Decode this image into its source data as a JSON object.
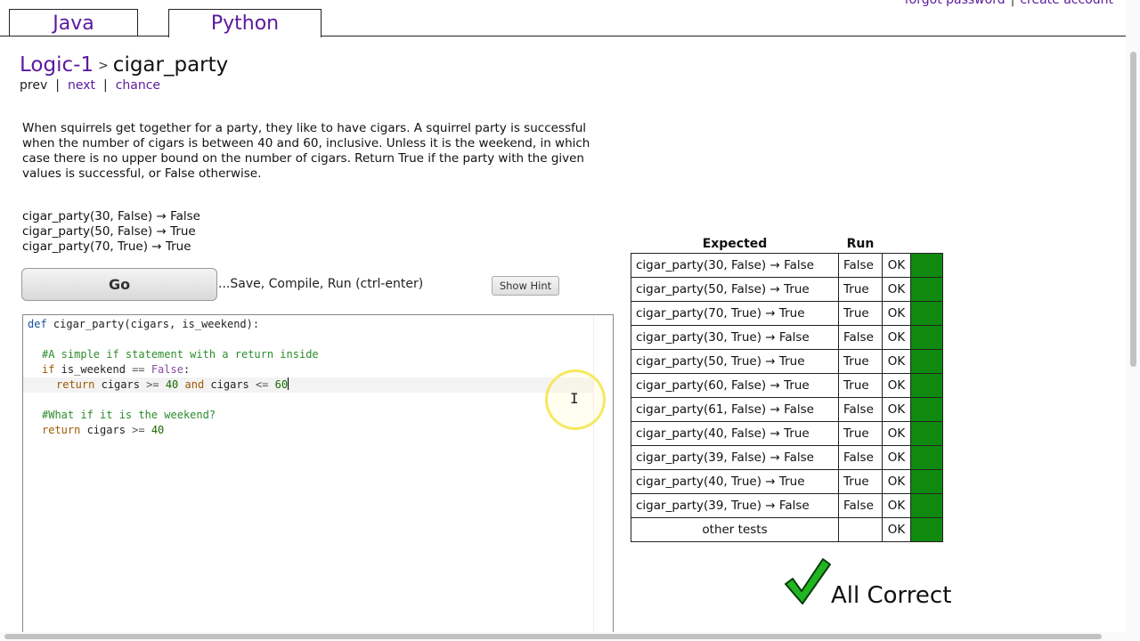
{
  "tabs": [
    {
      "label": "Java"
    },
    {
      "label": "Python"
    }
  ],
  "toplinks": {
    "forgot": "forgot password",
    "create": "create account",
    "sep": "|"
  },
  "title": {
    "crumb": "Logic-1",
    "gt": ">",
    "name": "cigar_party"
  },
  "nav": {
    "prev": "prev",
    "next": "next",
    "chance": "chance",
    "sep": "|"
  },
  "description": "When squirrels get together for a party, they like to have cigars. A squirrel party is successful when the number of cigars is between 40 and 60, inclusive. Unless it is the weekend, in which case there is no upper bound on the number of cigars. Return True if the party with the given values is successful, or False otherwise.",
  "examples": [
    "cigar_party(30, False) → False",
    "cigar_party(50, False) → True",
    "cigar_party(70, True) → True"
  ],
  "go": {
    "label": "Go",
    "text": "...Save, Compile, Run (ctrl-enter)",
    "hint": "Show Hint"
  },
  "code": {
    "l1_def": "def",
    "l1_sig": " cigar_party(cigars, is_weekend):",
    "l2": "#A simple if statement with a return inside",
    "l3_if": "if",
    "l3_mid": " is_weekend ",
    "l3_op": "==",
    "l3_bool": " False",
    "l3_colon": ":",
    "l4_ret": "return",
    "l4_a": " cigars ",
    "l4_op1": ">=",
    "l4_n1": " 40 ",
    "l4_and": "and",
    "l4_b": " cigars ",
    "l4_op2": "<=",
    "l4_n2": " 60",
    "l5": "#What if it is the weekend?",
    "l6_ret": "return",
    "l6_a": " cigars ",
    "l6_op": ">=",
    "l6_n": " 40"
  },
  "results": {
    "headers": {
      "expected": "Expected",
      "run": "Run"
    },
    "rows": [
      {
        "expected": "cigar_party(30, False) → False",
        "run": "False",
        "ok": "OK"
      },
      {
        "expected": "cigar_party(50, False) → True",
        "run": "True",
        "ok": "OK"
      },
      {
        "expected": "cigar_party(70, True) → True",
        "run": "True",
        "ok": "OK"
      },
      {
        "expected": "cigar_party(30, True) → False",
        "run": "False",
        "ok": "OK"
      },
      {
        "expected": "cigar_party(50, True) → True",
        "run": "True",
        "ok": "OK"
      },
      {
        "expected": "cigar_party(60, False) → True",
        "run": "True",
        "ok": "OK"
      },
      {
        "expected": "cigar_party(61, False) → False",
        "run": "False",
        "ok": "OK"
      },
      {
        "expected": "cigar_party(40, False) → True",
        "run": "True",
        "ok": "OK"
      },
      {
        "expected": "cigar_party(39, False) → False",
        "run": "False",
        "ok": "OK"
      },
      {
        "expected": "cigar_party(40, True) → True",
        "run": "True",
        "ok": "OK"
      },
      {
        "expected": "cigar_party(39, True) → False",
        "run": "False",
        "ok": "OK"
      }
    ],
    "other": {
      "label": "other tests",
      "ok": "OK"
    },
    "pass_color": "#0f8a0f"
  },
  "status": {
    "all_correct": "All Correct",
    "icon": "checkmark-icon"
  }
}
